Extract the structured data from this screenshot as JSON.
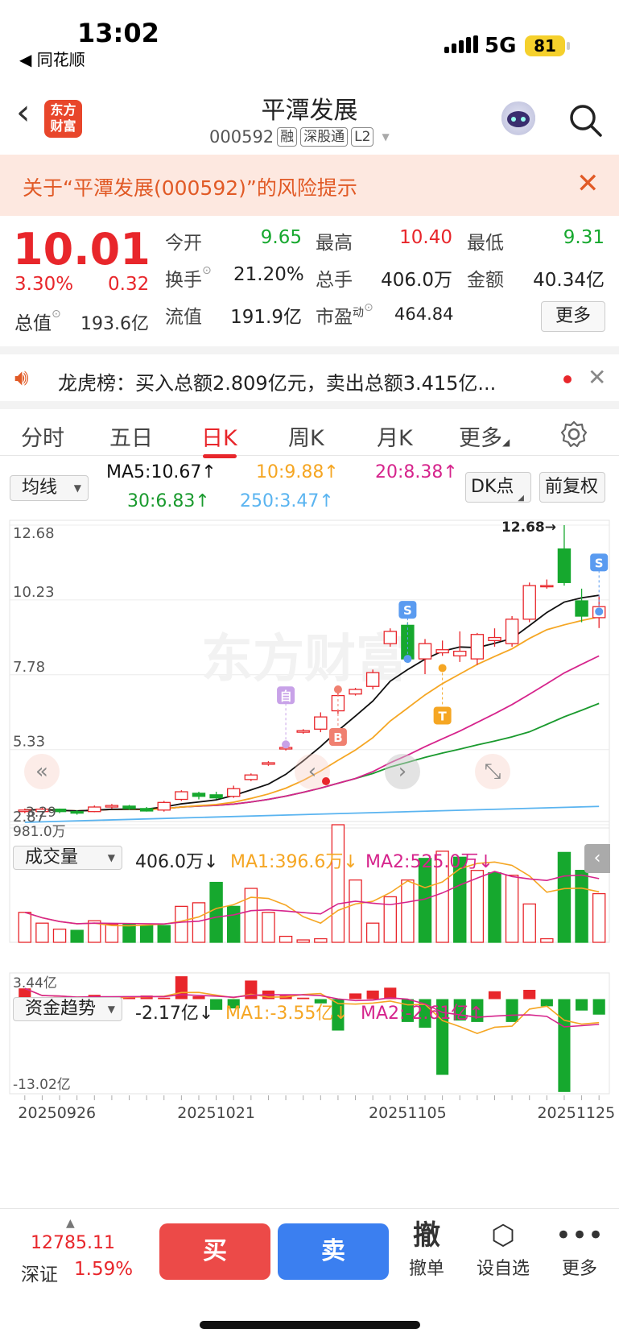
{
  "status_bar": {
    "time": "13:02",
    "back_app": "◀ 同花顺",
    "network": "5G",
    "battery": "81"
  },
  "header": {
    "logo": "东方财富",
    "stock_name": "平潭发展",
    "code": "000592",
    "tags": [
      "融",
      "深股通",
      "L2"
    ]
  },
  "risk_banner": {
    "text": "关于“平潭发展(000592)”的风险提示"
  },
  "quote": {
    "price": "10.01",
    "pct": "3.30%",
    "change": "0.32",
    "open_label": "今开",
    "open": "9.65",
    "high_label": "最高",
    "high": "10.40",
    "low_label": "最低",
    "low": "9.31",
    "turnover_label": "换手",
    "turnover": "21.20%",
    "volume_label": "总手",
    "volume": "406.0万",
    "amount_label": "金额",
    "amount": "40.34亿",
    "total_cap_label": "总值",
    "total_cap": "193.6亿",
    "float_cap_label": "流值",
    "float_cap": "191.9亿",
    "pe_label": "市盈",
    "pe_sup": "动",
    "pe": "464.84",
    "more_label": "更多"
  },
  "dragon_tiger": {
    "text": "龙虎榜：买入总额2.809亿元，卖出总额3.415亿..."
  },
  "tabs": [
    {
      "label": "分时"
    },
    {
      "label": "五日"
    },
    {
      "label": "日K"
    },
    {
      "label": "周K"
    },
    {
      "label": "月K"
    },
    {
      "label": "更多"
    }
  ],
  "ma_row": {
    "mode": "均线",
    "ma5": "MA5:10.67↑",
    "ma10": "10:9.88↑",
    "ma20": "20:8.38↑",
    "ma30": "30:6.83↑",
    "ma250": "250:3.47↑",
    "dk": "DK点",
    "adjust": "前复权"
  },
  "colors": {
    "up": "#e8262b",
    "down": "#16a82e",
    "ma5": "#111111",
    "ma10": "#f5a623",
    "ma20": "#d6248c",
    "ma30": "#1a9a2e",
    "ma250": "#5ab4f0"
  },
  "chart_data": {
    "type": "candlestick",
    "price_axis": {
      "ticks": [
        "12.68",
        "10.23",
        "7.78",
        "5.33",
        "2.87"
      ],
      "max_label": "12.68→",
      "cur_label": "3.29",
      "ylim": [
        2.87,
        12.68
      ]
    },
    "candles": [
      {
        "o": 3.3,
        "c": 3.35,
        "h": 3.4,
        "l": 3.25
      },
      {
        "o": 3.3,
        "c": 3.38,
        "h": 3.45,
        "l": 3.28
      },
      {
        "o": 3.38,
        "c": 3.3,
        "h": 3.4,
        "l": 3.25
      },
      {
        "o": 3.3,
        "c": 3.25,
        "h": 3.35,
        "l": 3.2
      },
      {
        "o": 3.3,
        "c": 3.45,
        "h": 3.5,
        "l": 3.28
      },
      {
        "o": 3.45,
        "c": 3.5,
        "h": 3.55,
        "l": 3.4
      },
      {
        "o": 3.48,
        "c": 3.4,
        "h": 3.52,
        "l": 3.35
      },
      {
        "o": 3.4,
        "c": 3.32,
        "h": 3.45,
        "l": 3.3
      },
      {
        "o": 3.35,
        "c": 3.6,
        "h": 3.65,
        "l": 3.3
      },
      {
        "o": 3.7,
        "c": 3.95,
        "h": 4.0,
        "l": 3.65
      },
      {
        "o": 3.9,
        "c": 3.8,
        "h": 3.95,
        "l": 3.7
      },
      {
        "o": 3.85,
        "c": 3.75,
        "h": 3.95,
        "l": 3.7
      },
      {
        "o": 3.8,
        "c": 4.05,
        "h": 4.15,
        "l": 3.75
      },
      {
        "o": 4.35,
        "c": 4.5,
        "h": 4.55,
        "l": 4.3
      },
      {
        "o": 4.85,
        "c": 4.9,
        "h": 4.95,
        "l": 4.8
      },
      {
        "o": 5.35,
        "c": 5.4,
        "h": 5.45,
        "l": 5.3
      },
      {
        "o": 5.9,
        "c": 5.95,
        "h": 6.0,
        "l": 5.85
      },
      {
        "o": 6.0,
        "c": 6.4,
        "h": 6.55,
        "l": 5.9
      },
      {
        "o": 6.6,
        "c": 7.1,
        "h": 7.3,
        "l": 6.5
      },
      {
        "o": 7.15,
        "c": 7.3,
        "h": 7.35,
        "l": 7.1
      },
      {
        "o": 7.4,
        "c": 7.85,
        "h": 7.95,
        "l": 7.3
      },
      {
        "o": 8.8,
        "c": 9.2,
        "h": 9.3,
        "l": 8.7
      },
      {
        "o": 9.4,
        "c": 8.3,
        "h": 9.5,
        "l": 8.2
      },
      {
        "o": 8.3,
        "c": 8.8,
        "h": 8.95,
        "l": 7.8
      },
      {
        "o": 8.5,
        "c": 8.6,
        "h": 8.9,
        "l": 8.4
      },
      {
        "o": 8.4,
        "c": 8.55,
        "h": 9.2,
        "l": 8.2
      },
      {
        "o": 8.3,
        "c": 9.1,
        "h": 9.15,
        "l": 8.1
      },
      {
        "o": 8.9,
        "c": 9.0,
        "h": 9.3,
        "l": 8.7
      },
      {
        "o": 8.8,
        "c": 9.6,
        "h": 9.7,
        "l": 8.7
      },
      {
        "o": 9.6,
        "c": 10.7,
        "h": 10.8,
        "l": 9.5
      },
      {
        "o": 10.7,
        "c": 10.7,
        "h": 10.9,
        "l": 10.6
      },
      {
        "o": 11.9,
        "c": 10.8,
        "h": 12.68,
        "l": 10.7
      },
      {
        "o": 10.2,
        "c": 9.7,
        "h": 10.6,
        "l": 9.5
      },
      {
        "o": 9.65,
        "c": 10.01,
        "h": 10.4,
        "l": 9.31
      }
    ],
    "markers": [
      {
        "text": "自"
      },
      {
        "text": "B"
      },
      {
        "text": "S"
      },
      {
        "text": "T"
      },
      {
        "text": "S"
      }
    ],
    "volume": {
      "selector": "成交量",
      "value": "406.0万↓",
      "ma1": "MA1:396.6万↓",
      "ma2": "MA2:525.0万↓",
      "max_label": "981.0万",
      "ylim": [
        0,
        981
      ],
      "values": [
        250,
        160,
        110,
        100,
        180,
        150,
        150,
        140,
        140,
        300,
        330,
        500,
        300,
        450,
        250,
        50,
        20,
        30,
        981,
        520,
        160,
        380,
        520,
        700,
        760,
        710,
        600,
        580,
        560,
        320,
        30,
        750,
        600,
        406
      ],
      "up": [
        true,
        true,
        true,
        false,
        true,
        true,
        false,
        false,
        false,
        true,
        true,
        false,
        false,
        true,
        true,
        true,
        true,
        true,
        true,
        true,
        true,
        true,
        true,
        false,
        true,
        false,
        true,
        false,
        true,
        true,
        true,
        false,
        false,
        true
      ]
    },
    "fund_flow": {
      "selector": "资金趋势",
      "value": "-2.17亿↓",
      "ma1": "MA1:-3.55亿↓",
      "ma2": "MA2:-2.61亿↑",
      "max_label": "3.44亿",
      "min_label": "-13.02亿",
      "ylim": [
        -13.02,
        3.44
      ],
      "values": [
        1.5,
        -0.5,
        0.3,
        -0.2,
        0.6,
        0.3,
        0.4,
        0.5,
        0.2,
        3.2,
        0.4,
        -1.5,
        -1.3,
        2.6,
        1.2,
        0.5,
        0.2,
        -0.6,
        -4.4,
        0.8,
        1.2,
        1.6,
        -3.2,
        -4.0,
        -10.6,
        -3.0,
        -3.2,
        1.1,
        -3.2,
        1.3,
        -1.0,
        -13.0,
        -1.6,
        -2.17
      ]
    },
    "dates": [
      "20250926",
      "20251021",
      "20251105",
      "20251125"
    ]
  },
  "bottom": {
    "index_value": "12785.11",
    "index_name": "深证",
    "index_pct": "1.59%",
    "buy": "买",
    "sell": "卖",
    "actions": [
      {
        "icon": "撤",
        "label": "撤单"
      },
      {
        "icon": "⬡",
        "label": "设自选"
      },
      {
        "icon": "•••",
        "label": "更多"
      }
    ]
  }
}
